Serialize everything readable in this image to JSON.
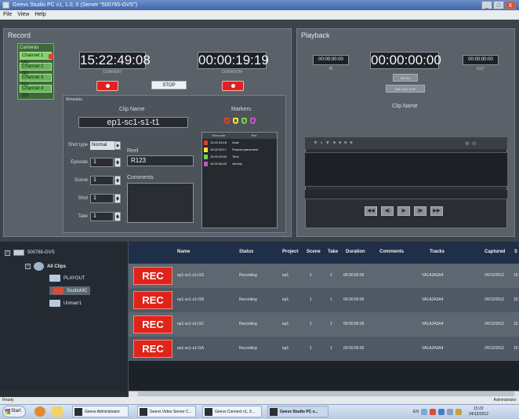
{
  "window": {
    "title": "Geevs Studio PC v1, 1.0, 0 (Server \"500765-GVS\")",
    "min": "_",
    "max": "□",
    "close": "X"
  },
  "menu": [
    "File",
    "View",
    "Help"
  ],
  "record": {
    "title": "Record",
    "cameras_label": "Cameras",
    "cameras": [
      "Channel 1 (A)",
      "Channel 2 (B)",
      "Channel 3 (C)",
      "Channel 4 (D)"
    ],
    "current_tc": "15:22:49:08",
    "current_label": "CURRENT",
    "duration_tc": "00:00:19:19",
    "duration_label": "DURATION",
    "stop_label": "STOP",
    "metadata_label": "Metadata",
    "clip_name_label": "Clip Name",
    "clip_name": "ep1-sc1-s1-t1",
    "markers_label": "Markers",
    "shot_type_label": "Shot type",
    "shot_type_value": "Normal",
    "episode_label": "Episode",
    "episode_value": "1",
    "scene_label": "Scene",
    "scene_value": "1",
    "shot_label": "Shot",
    "shot_value": "1",
    "take_label": "Take",
    "take_value": "1",
    "reel_label": "Reel",
    "reel_value": "R123",
    "comments_label": "Comments",
    "markers_table": {
      "headers": [
        "Timecode",
        "Text"
      ],
      "rows": [
        {
          "tc": "15:22:34:18",
          "text": "Goal",
          "color": "#e23c2c"
        },
        {
          "tc": "15:22:39:17",
          "text": "Product placement",
          "color": "#f2e23a"
        },
        {
          "tc": "15:22:45:04",
          "text": "Time",
          "color": "#77d24f"
        },
        {
          "tc": "15:22:46:20",
          "text": "Jeremy",
          "color": "#c256c8"
        }
      ]
    }
  },
  "playback": {
    "title": "Playback",
    "in_tc": "00:00:00:00",
    "in_label": "IN",
    "main_tc": "00:00:00:00",
    "out_tc": "00:00:00:00",
    "out_label": "OUT",
    "set_live": "Set live",
    "unload": "UNLOAD CLIP",
    "clip_name_label": "Clip Name",
    "transport": [
      "◀◀",
      "◀|",
      "▶",
      "|▶",
      "▶▶"
    ]
  },
  "tree": {
    "server": "500765-GVS",
    "all_clips": "All Clips",
    "children": [
      "PLAYOUT",
      "StudioMC",
      "Unmarr1"
    ]
  },
  "grid": {
    "headers": [
      "Name",
      "Status",
      "Project",
      "Scene",
      "Take",
      "Duration",
      "Comments",
      "Tracks",
      "Captured",
      "S"
    ],
    "rows": [
      {
        "badge": "REC",
        "name": "ep1-sc1-s1-t1D",
        "status": "Recording",
        "project": "ep1",
        "scene": "1",
        "take": "1",
        "duration": "00:00:00:00",
        "tracks": "VA1A2A3A4",
        "captured": "24/12/2012",
        "s": "15"
      },
      {
        "badge": "REC",
        "name": "ep1-sc1-s1-t1B",
        "status": "Recording",
        "project": "ep1",
        "scene": "1",
        "take": "1",
        "duration": "00:00:00:00",
        "tracks": "VA1A2A3A4",
        "captured": "24/12/2012",
        "s": "15"
      },
      {
        "badge": "REC",
        "name": "ep1-sc1-s1-t1C",
        "status": "Recording",
        "project": "ep1",
        "scene": "1",
        "take": "1",
        "duration": "00:00:00:00",
        "tracks": "VA1A2A3A4",
        "captured": "24/12/2012",
        "s": "15"
      },
      {
        "badge": "REC",
        "name": "ep1-sc1-s1-t1A",
        "status": "Recording",
        "project": "ep1",
        "scene": "1",
        "take": "1",
        "duration": "00:00:00:00",
        "tracks": "VA1A2A3A4",
        "captured": "24/12/2012",
        "s": "15"
      }
    ]
  },
  "status": {
    "left": "Ready",
    "right": "Administrator"
  },
  "taskbar": {
    "start": "Start",
    "tasks": [
      "Geevs Administrator",
      "Geevs Video Server C...",
      "Geevs Connect v1, 3...",
      "Geevs Studio PC v..."
    ],
    "lang": "EN",
    "time": "15:22",
    "date": "24/12/2012"
  },
  "colors": {
    "rec_red": "#e02419",
    "camera_green": "#67b35a",
    "panel": "#5b6169",
    "grid_header": "#1f2f47"
  }
}
